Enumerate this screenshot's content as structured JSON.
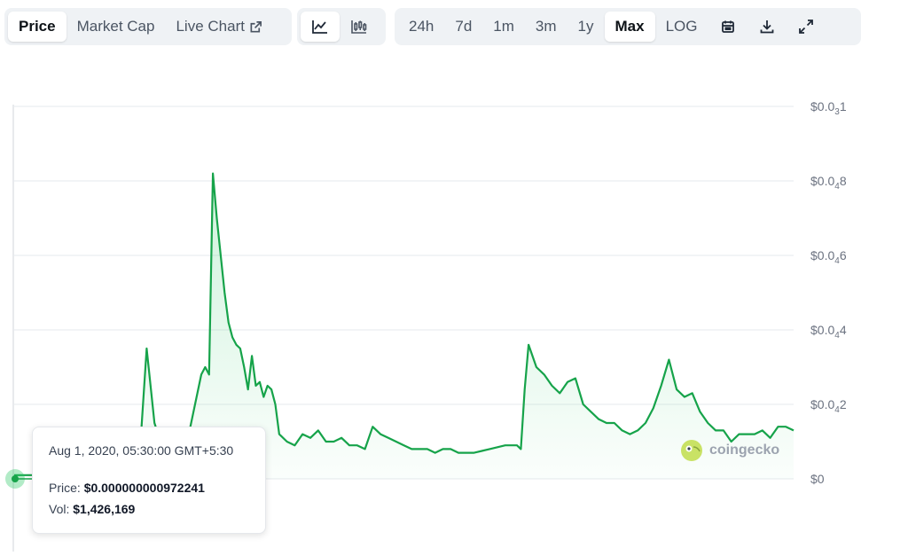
{
  "toolbar": {
    "tabs": [
      {
        "label": "Price",
        "active": true
      },
      {
        "label": "Market Cap",
        "active": false
      },
      {
        "label": "Live Chart",
        "active": false
      }
    ],
    "chart_types": [
      {
        "icon": "line-chart-icon",
        "active": true
      },
      {
        "icon": "candlestick-chart-icon",
        "active": false
      }
    ],
    "ranges": [
      {
        "label": "24h",
        "active": false
      },
      {
        "label": "7d",
        "active": false
      },
      {
        "label": "1m",
        "active": false
      },
      {
        "label": "3m",
        "active": false
      },
      {
        "label": "1y",
        "active": false
      },
      {
        "label": "Max",
        "active": true
      },
      {
        "label": "LOG",
        "active": false
      }
    ],
    "tools": [
      "calendar-icon",
      "download-icon",
      "fullscreen-icon"
    ]
  },
  "tooltip": {
    "date": "Aug 1, 2020, 05:30:00 GMT+5:30",
    "price_label": "Price:",
    "price_value": "$0.000000000972241",
    "vol_label": "Vol:",
    "vol_value": "$1,426,169"
  },
  "branding": {
    "name": "coingecko",
    "icon": "coingecko-logo-icon"
  },
  "colors": {
    "line": "#16a34a",
    "fill": "#22c55e",
    "grid": "#e6e9ee",
    "axis_text": "#6b7280",
    "marker": "#16a34a"
  },
  "chart_data": {
    "type": "area",
    "ylim": [
      0,
      10
    ],
    "y_tick_values": [
      0,
      2,
      4,
      6,
      8,
      10
    ],
    "y_tick_labels": [
      {
        "prefix": "$0",
        "sub": "",
        "digit": ""
      },
      {
        "prefix": "$0.0",
        "sub": "4",
        "digit": "2"
      },
      {
        "prefix": "$0.0",
        "sub": "4",
        "digit": "4"
      },
      {
        "prefix": "$0.0",
        "sub": "4",
        "digit": "6"
      },
      {
        "prefix": "$0.0",
        "sub": "4",
        "digit": "8"
      },
      {
        "prefix": "$0.0",
        "sub": "3",
        "digit": "1"
      }
    ],
    "x": [
      0,
      0.02,
      0.14,
      0.16,
      0.17,
      0.18,
      0.2,
      0.21,
      0.215,
      0.22,
      0.24,
      0.245,
      0.25,
      0.255,
      0.26,
      0.265,
      0.27,
      0.275,
      0.28,
      0.285,
      0.29,
      0.295,
      0.3,
      0.305,
      0.31,
      0.315,
      0.32,
      0.325,
      0.33,
      0.335,
      0.34,
      0.35,
      0.36,
      0.37,
      0.38,
      0.39,
      0.4,
      0.41,
      0.42,
      0.43,
      0.44,
      0.45,
      0.46,
      0.47,
      0.48,
      0.49,
      0.5,
      0.51,
      0.52,
      0.53,
      0.54,
      0.55,
      0.56,
      0.57,
      0.58,
      0.59,
      0.6,
      0.61,
      0.62,
      0.63,
      0.64,
      0.645,
      0.65,
      0.655,
      0.66,
      0.67,
      0.68,
      0.69,
      0.7,
      0.71,
      0.72,
      0.73,
      0.74,
      0.75,
      0.76,
      0.77,
      0.78,
      0.79,
      0.8,
      0.81,
      0.82,
      0.83,
      0.84,
      0.85,
      0.86,
      0.87,
      0.88,
      0.89,
      0.9,
      0.91,
      0.92,
      0.93,
      0.94,
      0.95,
      0.96,
      0.97,
      0.98,
      0.99,
      1.0
    ],
    "values": [
      0.1,
      0.1,
      0.1,
      0.3,
      3.5,
      1.5,
      0.2,
      0.2,
      0.2,
      0.8,
      2.8,
      3.0,
      2.8,
      8.2,
      7.0,
      6.0,
      5.0,
      4.2,
      3.8,
      3.6,
      3.5,
      3.0,
      2.4,
      3.3,
      2.5,
      2.6,
      2.2,
      2.5,
      2.4,
      2.0,
      1.2,
      1.0,
      0.9,
      1.2,
      1.1,
      1.3,
      1.0,
      1.0,
      1.1,
      0.9,
      0.9,
      0.8,
      1.4,
      1.2,
      1.1,
      1.0,
      0.9,
      0.8,
      0.8,
      0.8,
      0.7,
      0.8,
      0.8,
      0.7,
      0.7,
      0.7,
      0.75,
      0.8,
      0.85,
      0.9,
      0.9,
      0.9,
      0.8,
      2.4,
      3.6,
      3.0,
      2.8,
      2.5,
      2.3,
      2.6,
      2.7,
      2.0,
      1.8,
      1.6,
      1.5,
      1.5,
      1.3,
      1.2,
      1.3,
      1.5,
      1.9,
      2.5,
      3.2,
      2.4,
      2.2,
      2.3,
      1.8,
      1.5,
      1.3,
      1.3,
      1.0,
      1.2,
      1.2,
      1.2,
      1.3,
      1.1,
      1.4,
      1.4,
      1.3
    ]
  }
}
